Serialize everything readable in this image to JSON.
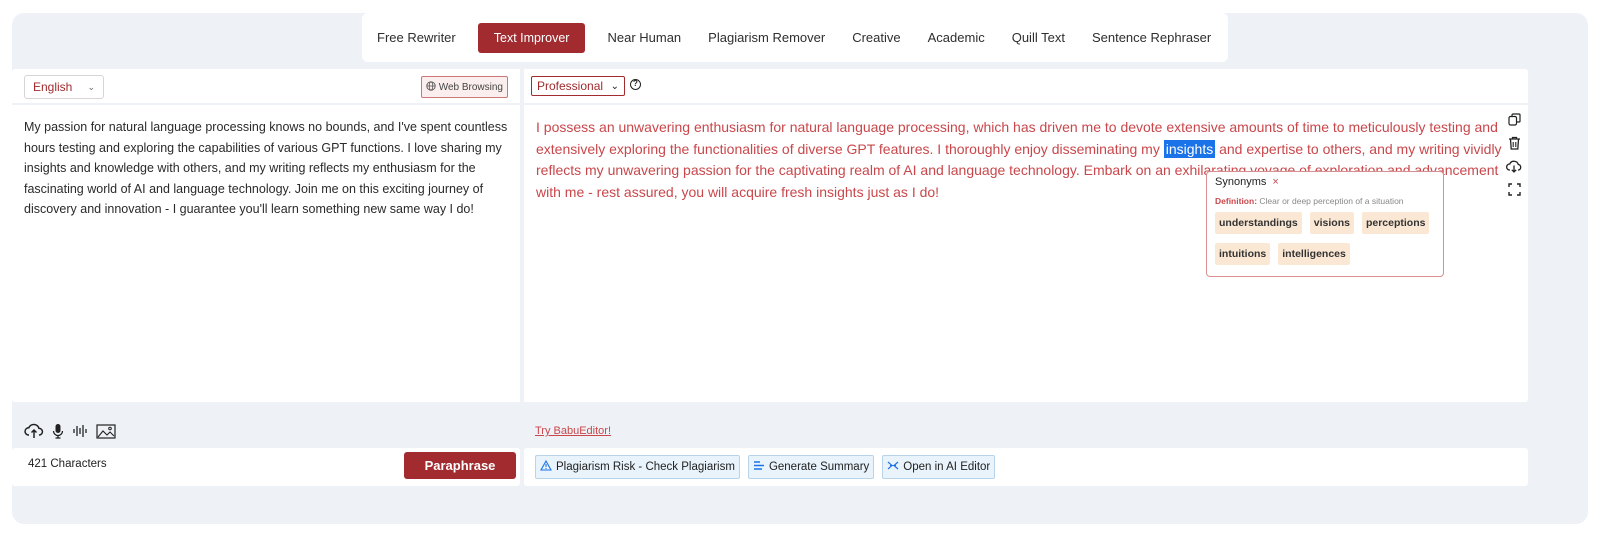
{
  "modes": [
    {
      "label": "Free Rewriter",
      "active": false
    },
    {
      "label": "Text Improver",
      "active": true
    },
    {
      "label": "Near Human",
      "active": false
    },
    {
      "label": "Plagiarism Remover",
      "active": false
    },
    {
      "label": "Creative",
      "active": false
    },
    {
      "label": "Academic",
      "active": false
    },
    {
      "label": "Quill Text",
      "active": false
    },
    {
      "label": "Sentence Rephraser",
      "active": false
    }
  ],
  "left": {
    "language": "English",
    "web_browsing_label": "Web Browsing",
    "input_text": "My passion for natural language processing knows no bounds, and I've spent countless hours testing and exploring the capabilities of various GPT functions. I love sharing my insights and knowledge with others, and my writing reflects my enthusiasm for the fascinating world of AI and language technology. Join me on this exciting journey of discovery and innovation - I guarantee you'll learn something new same way I do!",
    "char_count": "421 Characters",
    "paraphrase_label": "Paraphrase"
  },
  "right": {
    "tone": "Professional",
    "output_before": "I possess an unwavering enthusiasm for natural language processing, which has driven me to devote extensive amounts of time to meticulously testing and extensively exploring the functionalities of diverse GPT features. I thoroughly enjoy disseminating my ",
    "output_highlight": "insights",
    "output_after": " and expertise to others, and my writing vividly reflects my unwavering passion for the captivating realm of AI and language technology. Embark on an exhilarating voyage of exploration and advancement with me - rest assured, you will acquire fresh insights just as I do!",
    "try_link": "Try BabuEditor!",
    "actions": [
      {
        "label": "Plagiarism Risk - Check Plagiarism",
        "icon": "warning-icon"
      },
      {
        "label": "Generate Summary",
        "icon": "summary-icon"
      },
      {
        "label": "Open in AI Editor",
        "icon": "editor-icon"
      }
    ]
  },
  "synonyms": {
    "title": "Synonyms",
    "close": "×",
    "definition_label": "Definition:",
    "definition_text": "Clear or deep perception of a situation",
    "items": [
      "understandings",
      "visions",
      "perceptions",
      "intuitions",
      "intelligences"
    ]
  },
  "colors": {
    "accent": "#a12b2f",
    "output_text": "#c9474b",
    "highlight": "#1a73e8",
    "chip": "#fbe8d4"
  }
}
